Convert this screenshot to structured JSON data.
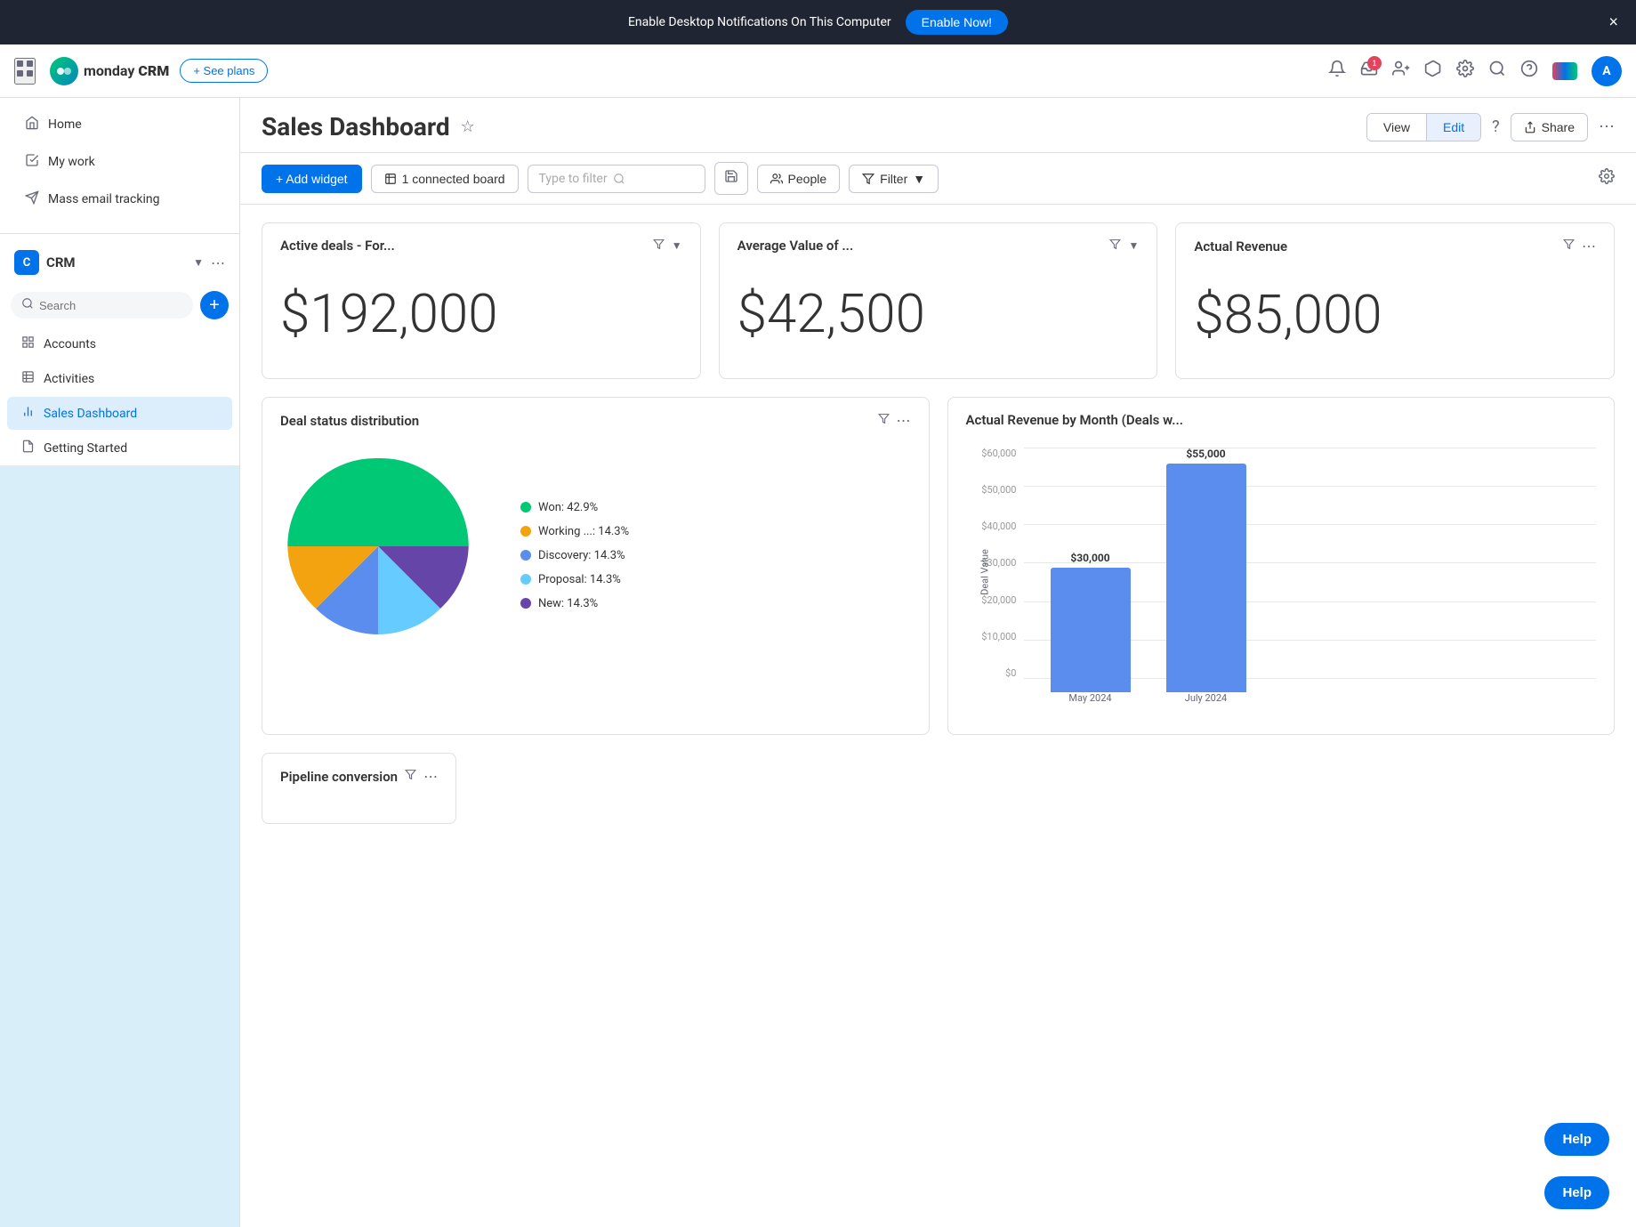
{
  "notif_bar": {
    "message": "Enable Desktop Notifications On This Computer",
    "enable_label": "Enable Now!",
    "close_label": "×"
  },
  "header": {
    "logo_initials": "m",
    "brand_name": "monday",
    "brand_suffix": "CRM",
    "see_plans_label": "+ See plans",
    "inbox_badge": "1",
    "avatar_initials": "A"
  },
  "sidebar": {
    "nav_items": [
      {
        "label": "Home",
        "icon": "🏠"
      },
      {
        "label": "My work",
        "icon": "✅"
      },
      {
        "label": "Mass email tracking",
        "icon": "✉️"
      }
    ],
    "workspace_name": "CRM",
    "search_placeholder": "Search",
    "menu_items": [
      {
        "label": "Accounts",
        "icon": "grid",
        "active": false
      },
      {
        "label": "Activities",
        "icon": "table",
        "active": false
      },
      {
        "label": "Sales Dashboard",
        "icon": "chart",
        "active": true
      },
      {
        "label": "Getting Started",
        "icon": "doc",
        "active": false
      }
    ]
  },
  "dashboard": {
    "title": "Sales Dashboard",
    "view_label": "View",
    "edit_label": "Edit",
    "share_label": "Share",
    "add_widget_label": "+ Add widget",
    "connected_board_label": "1 connected board",
    "type_to_filter_placeholder": "Type to filter",
    "people_label": "People",
    "filter_label": "Filter",
    "widgets": {
      "active_deals": {
        "title": "Active deals - For...",
        "value": "$192,000"
      },
      "average_value": {
        "title": "Average Value of ...",
        "value": "$42,500"
      },
      "actual_revenue": {
        "title": "Actual Revenue",
        "value": "$85,000"
      },
      "deal_status": {
        "title": "Deal status distribution",
        "legend": [
          {
            "label": "Won: 42.9%",
            "color": "#00c875"
          },
          {
            "label": "Working ...: 14.3%",
            "color": "#f2a30f"
          },
          {
            "label": "Discovery: 14.3%",
            "color": "#5b8def"
          },
          {
            "label": "Proposal: 14.3%",
            "color": "#66ccff"
          },
          {
            "label": "New: 14.3%",
            "color": "#6645a9"
          }
        ]
      },
      "actual_revenue_by_month": {
        "title": "Actual Revenue by Month (Deals w...",
        "y_labels": [
          "$60,000",
          "$50,000",
          "$40,000",
          "$30,000",
          "$20,000",
          "$10,000",
          "$0"
        ],
        "bars": [
          {
            "month": "May 2024",
            "value": "$30,000",
            "height_pct": 50
          },
          {
            "month": "July 2024",
            "value": "$55,000",
            "height_pct": 92
          }
        ],
        "y_axis_label": "Deal Value"
      },
      "pipeline": {
        "title": "Pipeline conversion"
      }
    }
  },
  "help_btn_label": "Help"
}
